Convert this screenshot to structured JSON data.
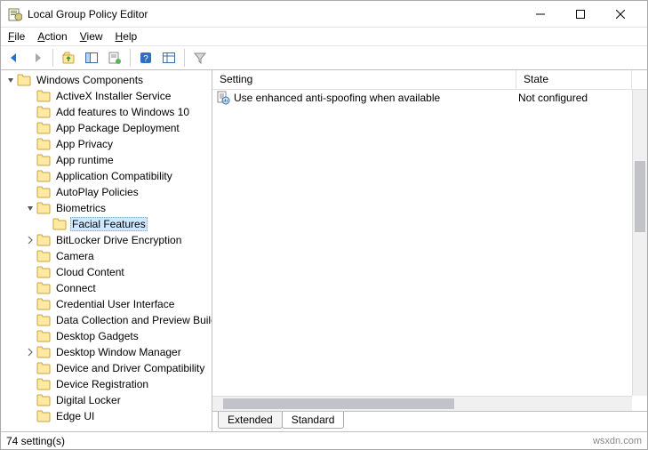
{
  "window": {
    "title": "Local Group Policy Editor"
  },
  "menu": {
    "file": "File",
    "action": "Action",
    "view": "View",
    "help": "Help"
  },
  "tree": {
    "root": "Windows Components",
    "items": [
      {
        "label": "ActiveX Installer Service",
        "depth": 1,
        "arrow": "none"
      },
      {
        "label": "Add features to Windows 10",
        "depth": 1,
        "arrow": "none"
      },
      {
        "label": "App Package Deployment",
        "depth": 1,
        "arrow": "none"
      },
      {
        "label": "App Privacy",
        "depth": 1,
        "arrow": "none"
      },
      {
        "label": "App runtime",
        "depth": 1,
        "arrow": "none"
      },
      {
        "label": "Application Compatibility",
        "depth": 1,
        "arrow": "none"
      },
      {
        "label": "AutoPlay Policies",
        "depth": 1,
        "arrow": "none"
      },
      {
        "label": "Biometrics",
        "depth": 1,
        "arrow": "open"
      },
      {
        "label": "Facial Features",
        "depth": 2,
        "arrow": "none",
        "selected": true
      },
      {
        "label": "BitLocker Drive Encryption",
        "depth": 1,
        "arrow": "closed"
      },
      {
        "label": "Camera",
        "depth": 1,
        "arrow": "none"
      },
      {
        "label": "Cloud Content",
        "depth": 1,
        "arrow": "none"
      },
      {
        "label": "Connect",
        "depth": 1,
        "arrow": "none"
      },
      {
        "label": "Credential User Interface",
        "depth": 1,
        "arrow": "none"
      },
      {
        "label": "Data Collection and Preview Build",
        "depth": 1,
        "arrow": "none"
      },
      {
        "label": "Desktop Gadgets",
        "depth": 1,
        "arrow": "none"
      },
      {
        "label": "Desktop Window Manager",
        "depth": 1,
        "arrow": "closed"
      },
      {
        "label": "Device and Driver Compatibility",
        "depth": 1,
        "arrow": "none"
      },
      {
        "label": "Device Registration",
        "depth": 1,
        "arrow": "none"
      },
      {
        "label": "Digital Locker",
        "depth": 1,
        "arrow": "none"
      },
      {
        "label": "Edge UI",
        "depth": 1,
        "arrow": "none"
      }
    ]
  },
  "list": {
    "headers": {
      "setting": "Setting",
      "state": "State"
    },
    "rows": [
      {
        "setting": "Use enhanced anti-spoofing when available",
        "state": "Not configured"
      }
    ]
  },
  "tabs": {
    "extended": "Extended",
    "standard": "Standard"
  },
  "status": {
    "left": "74 setting(s)",
    "right": "wsxdn.com"
  }
}
